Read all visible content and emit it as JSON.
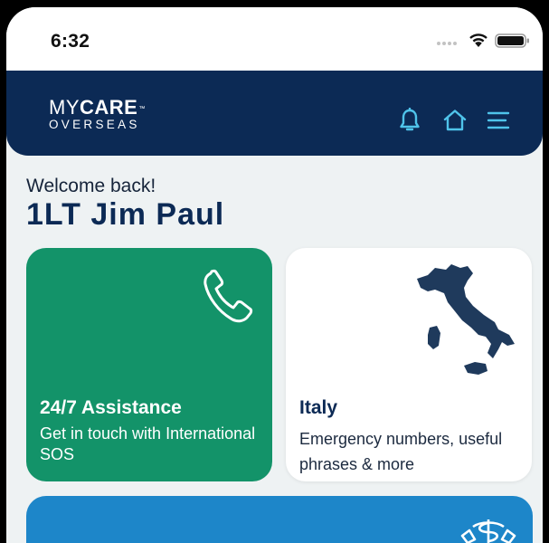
{
  "status_bar": {
    "time": "6:32",
    "icons": [
      "cellular-signal-icon",
      "wifi-icon",
      "battery-icon"
    ]
  },
  "header": {
    "logo": {
      "my": "MY",
      "care": "CARE",
      "tm": "™",
      "overseas": "OVERSEAS"
    },
    "actions": [
      "bell-icon",
      "home-icon",
      "menu-icon"
    ]
  },
  "welcome": {
    "greeting": "Welcome back!",
    "name": "1LT Jim Paul"
  },
  "cards": [
    {
      "id": "assistance",
      "title": "24/7 Assistance",
      "subtitle": "Get in touch with International SOS",
      "icon": "phone-icon",
      "color": "#139369"
    },
    {
      "id": "country",
      "title": "Italy",
      "subtitle": "Emergency numbers, useful phrases & more",
      "icon": "italy-map-icon",
      "color": "#ffffff"
    },
    {
      "id": "medical",
      "icon": "medical-caduceus-icon",
      "color": "#1d86c9"
    }
  ],
  "colors": {
    "header_bg": "#0c2a55",
    "accent_icon": "#4fc3ea",
    "assist_green": "#139369",
    "medical_blue": "#1d86c9",
    "page_bg": "#eef2f3"
  }
}
